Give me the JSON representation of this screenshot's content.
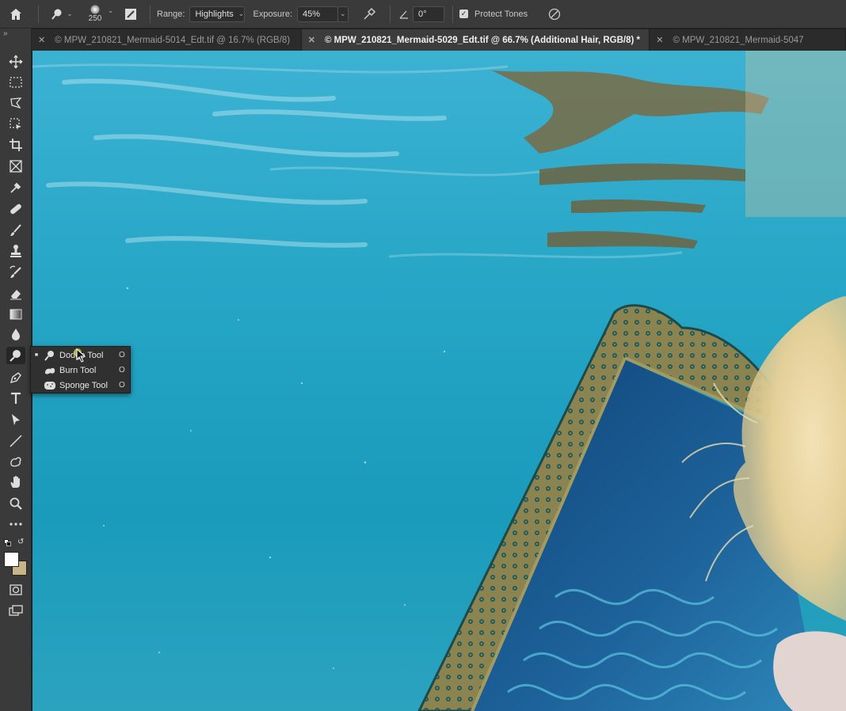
{
  "options_bar": {
    "brush_size": "250",
    "range_label": "Range:",
    "range_value": "Highlights",
    "exposure_label": "Exposure:",
    "exposure_value": "45%",
    "angle_value": "0°",
    "protect_tones_label": "Protect Tones",
    "protect_tones_checked": true
  },
  "tabs": [
    {
      "label": "MPW_210821_Mermaid-5014_Edt.tif @ 16.7% (RGB/8)",
      "active": false
    },
    {
      "label": "MPW_210821_Mermaid-5029_Edt.tif @ 66.7% (Additional Hair, RGB/8) *",
      "active": true
    },
    {
      "label": "MPW_210821_Mermaid-5047",
      "active": false
    }
  ],
  "toolbar": {
    "items": [
      "move-tool",
      "marquee-tool",
      "lasso-tool",
      "object-select-tool",
      "crop-tool",
      "frame-tool",
      "eyedropper-tool",
      "healing-tool",
      "brush-tool",
      "stamp-tool",
      "history-brush-tool",
      "eraser-tool",
      "gradient-tool",
      "blur-tool",
      "dodge-tool",
      "pen-tool",
      "type-tool",
      "path-select-tool",
      "line-tool",
      "custom-shape-tool",
      "hand-tool",
      "zoom-tool",
      "more-tools",
      "default-colors",
      "foreground-color",
      "quick-mask",
      "screen-mode"
    ],
    "foreground_color": "#ffffff",
    "background_color": "#c7b489"
  },
  "flyout": {
    "items": [
      {
        "label": "Dodge Tool",
        "shortcut": "O",
        "selected": true
      },
      {
        "label": "Burn Tool",
        "shortcut": "O",
        "selected": false
      },
      {
        "label": "Sponge Tool",
        "shortcut": "O",
        "selected": false
      }
    ]
  },
  "colors": {
    "water_top": "#2fa8c9",
    "water_bottom": "#1a9ab8",
    "frame_gold": "#8f8652",
    "mirror_blue": "#1c5e94",
    "hair": "#e9d7a8"
  }
}
